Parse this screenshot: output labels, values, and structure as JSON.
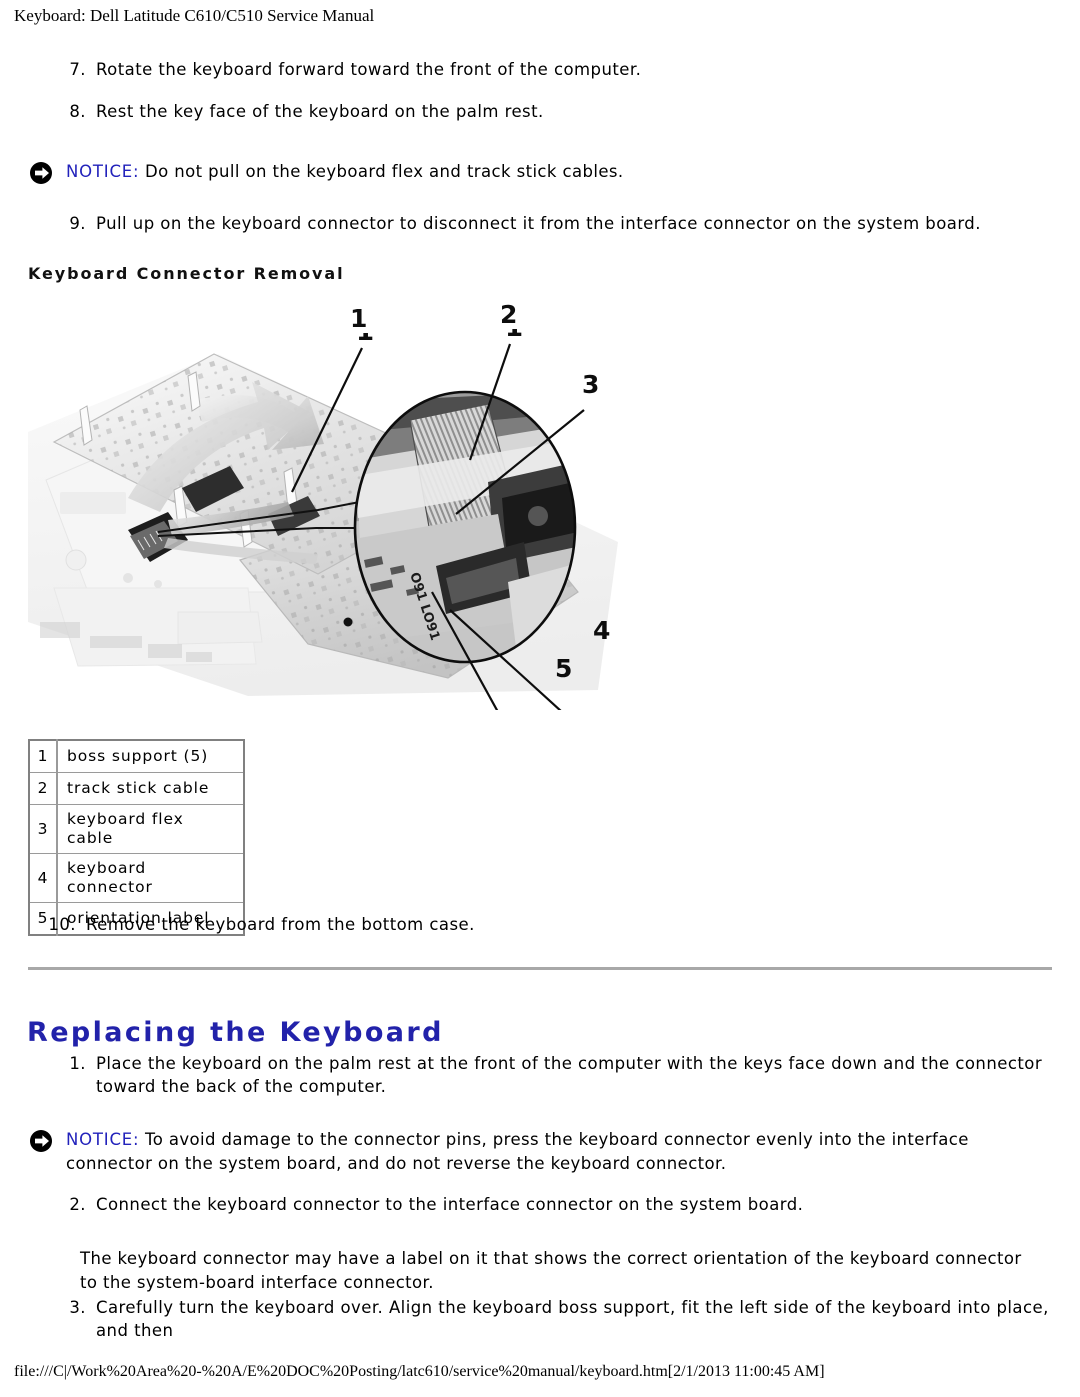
{
  "document": {
    "header_title": "Keyboard: Dell Latitude C610/C510 Service Manual",
    "footer_path": "file:///C|/Work%20Area%20-%20A/E%20DOC%20Posting/latc610/service%20manual/keyboard.htm[2/1/2013 11:00:45 AM]"
  },
  "colors": {
    "notice_label": "#2222bb",
    "heading_blue": "#2222aa",
    "rule_gray": "#a8a8a8",
    "table_border": "#9a9a9a"
  },
  "removal_steps": [
    {
      "num": "7.",
      "text": "Rotate the keyboard forward toward the front of the computer."
    },
    {
      "num": "8.",
      "text": "Rest the key face of the keyboard on the palm rest."
    },
    {
      "num": "9.",
      "text": "Pull up on the keyboard connector to disconnect it from the interface connector on the system board."
    },
    {
      "num": "10.",
      "text": "Remove the keyboard from the bottom case."
    }
  ],
  "notice_removal": {
    "icon": "notice-arrow-icon",
    "label": "NOTICE:",
    "text": " Do not pull on the keyboard flex and track stick cables."
  },
  "figure": {
    "caption": "Keyboard Connector Removal",
    "alt": "Grayscale photo of a Dell Latitude laptop with the keyboard lifted and rotated forward, showing the keyboard connector area with a magnified circular inset.",
    "callouts": [
      "1",
      "2",
      "3",
      "4",
      "5"
    ]
  },
  "legend": {
    "rows": [
      {
        "index": "1",
        "label": "boss support (5)"
      },
      {
        "index": "2",
        "label": "track stick cable"
      },
      {
        "index": "3",
        "label": "keyboard flex cable"
      },
      {
        "index": "4",
        "label": "keyboard connector"
      },
      {
        "index": "5",
        "label": "orientation label"
      }
    ]
  },
  "replacing_section": {
    "heading": "Replacing the Keyboard",
    "steps": [
      {
        "num": "1.",
        "text": "Place the keyboard on the palm rest at the front of the computer with the keys face down and the connector toward the back of the computer."
      },
      {
        "num": "2.",
        "text": "Connect the keyboard connector to the interface connector on the system board."
      },
      {
        "num": "3.",
        "text": "Carefully turn the keyboard over. Align the keyboard boss support, fit the left side of the keyboard into place, and then"
      }
    ],
    "notice": {
      "icon": "notice-arrow-icon",
      "label": "NOTICE:",
      "text": " To avoid damage to the connector pins, press the keyboard connector evenly into the interface connector on the system board, and do not reverse the keyboard connector."
    },
    "note_paragraph": "The keyboard connector may have a label on it that shows the correct orientation of the keyboard connector to the system-board interface connector."
  }
}
